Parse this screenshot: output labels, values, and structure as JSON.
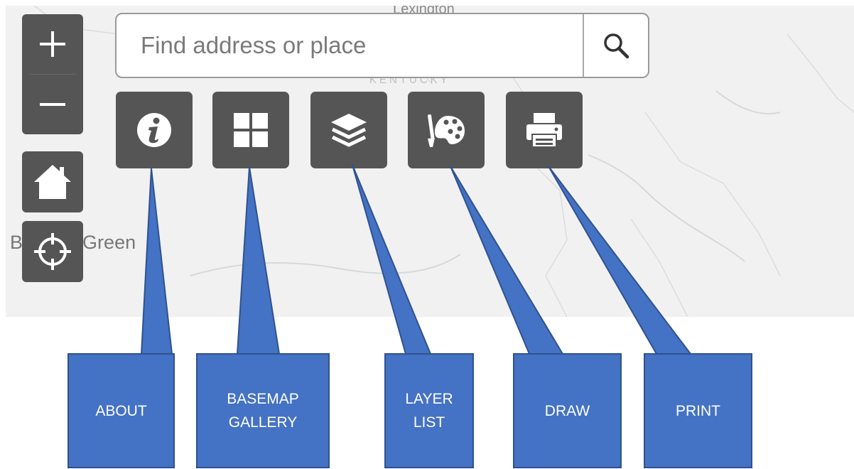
{
  "map": {
    "labels": {
      "city_top": "Lexington",
      "state": "KENTUCKY",
      "city_left": "Bowling Green"
    }
  },
  "zoom": {
    "in_symbol": "+",
    "out_symbol": "−"
  },
  "search": {
    "placeholder": "Find address or place",
    "value": ""
  },
  "widgets": [
    {
      "id": "about",
      "icon": "info-icon"
    },
    {
      "id": "basemap",
      "icon": "grid-icon"
    },
    {
      "id": "layers",
      "icon": "layers-icon"
    },
    {
      "id": "draw",
      "icon": "palette-icon"
    },
    {
      "id": "print",
      "icon": "printer-icon"
    }
  ],
  "callouts": {
    "about": [
      "ABOUT"
    ],
    "basemap": [
      "BASEMAP",
      "GALLERY"
    ],
    "layer": [
      "LAYER",
      "LIST"
    ],
    "draw": [
      "DRAW"
    ],
    "print": [
      "PRINT"
    ]
  },
  "colors": {
    "map_bg": "#f1f1f1",
    "button_bg": "#555555",
    "callout_fill": "#4472c4",
    "callout_border": "#2f528f"
  }
}
